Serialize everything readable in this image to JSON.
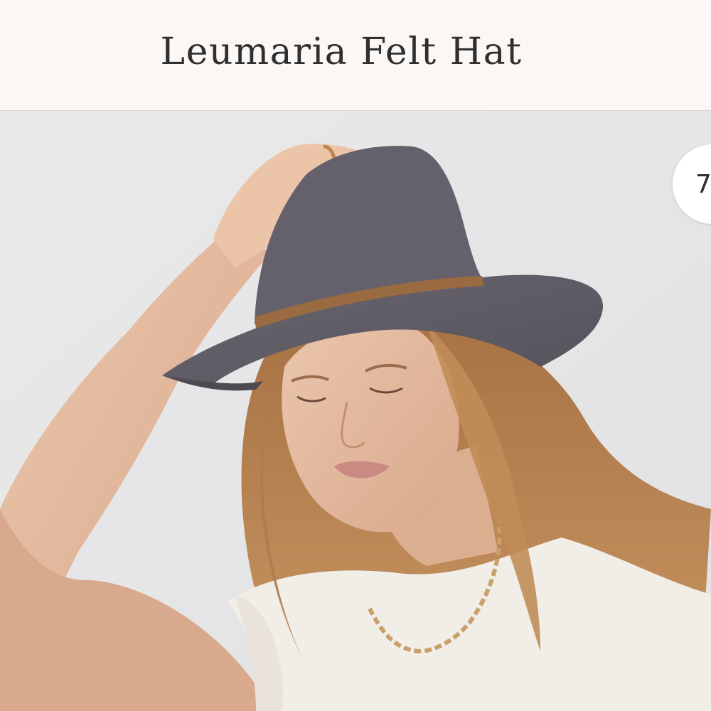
{
  "header": {
    "title": "Leumaria Felt Hat"
  },
  "gallery": {
    "image_count_label": "7",
    "photo_icon": "product-photo",
    "colors": {
      "backdrop": "#e6e6e7",
      "hat": "#5d5a63",
      "hat_band": "#9a6a40",
      "hair": "#b9824e",
      "skin": "#e7bea3",
      "shirt": "#f1ede7",
      "chain": "#c9a06a"
    }
  }
}
